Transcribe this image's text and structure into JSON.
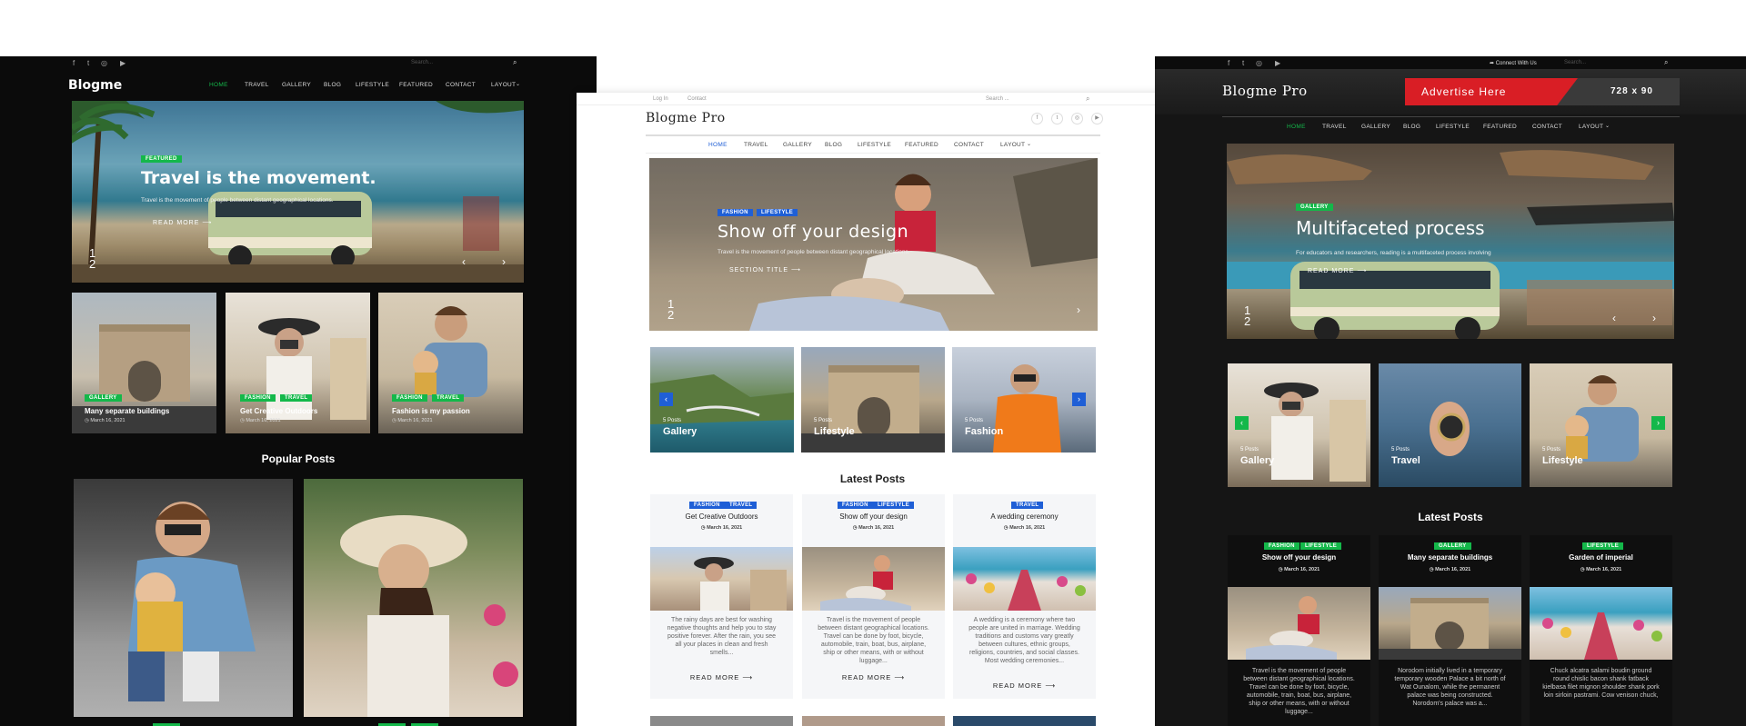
{
  "left": {
    "topbar": {
      "search_placeholder": "Search..."
    },
    "brand": "Blogme",
    "nav": [
      "HOME",
      "TRAVEL",
      "GALLERY",
      "BLOG",
      "LIFESTYLE",
      "FEATURED",
      "CONTACT",
      "LAYOUT"
    ],
    "hero": {
      "tag": "FEATURED",
      "title": "Travel is the movement.",
      "subtitle": "Travel is the movement of people between distant geographical locations.",
      "read_more": "READ MORE",
      "page_current": "1",
      "page_total": "2"
    },
    "tiles": [
      {
        "tags": [
          "GALLERY"
        ],
        "title": "Many separate buildings",
        "date": "March 16, 2021"
      },
      {
        "tags": [
          "FASHION",
          "TRAVEL"
        ],
        "title": "Get Creative Outdoors",
        "date": "March 16, 2021"
      },
      {
        "tags": [
          "FASHION",
          "TRAVEL"
        ],
        "title": "Fashion is my passion",
        "date": "March 16, 2021"
      }
    ],
    "popular_heading": "Popular Posts"
  },
  "center": {
    "topbar": {
      "login": "Log In",
      "contact": "Contact",
      "search_placeholder": "Search ..."
    },
    "brand": "Blogme Pro",
    "nav": [
      "HOME",
      "TRAVEL",
      "GALLERY",
      "BLOG",
      "LIFESTYLE",
      "FEATURED",
      "CONTACT",
      "LAYOUT"
    ],
    "hero": {
      "tags": [
        "FASHION",
        "LIFESTYLE"
      ],
      "title": "Show off your design",
      "subtitle": "Travel is the movement of people between distant geographical locations.",
      "section_title": "SECTION TITLE",
      "page_current": "1",
      "page_total": "2"
    },
    "categories": [
      {
        "count": "5 Posts",
        "name": "Gallery"
      },
      {
        "count": "5 Posts",
        "name": "Lifestyle"
      },
      {
        "count": "5 Posts",
        "name": "Fashion"
      }
    ],
    "latest_heading": "Latest Posts",
    "posts": [
      {
        "tags": [
          "FASHION",
          "TRAVEL"
        ],
        "title": "Get Creative Outdoors",
        "date": "March 16, 2021",
        "excerpt": "The rainy days are best for washing negative thoughts and help you to stay positive forever. After the rain, you see all your places in clean and fresh smells...",
        "read_more": "READ MORE"
      },
      {
        "tags": [
          "FASHION",
          "LIFESTYLE"
        ],
        "title": "Show off your design",
        "date": "March 16, 2021",
        "excerpt": "Travel is the movement of people between distant geographical locations. Travel can be done by foot, bicycle, automobile, train, boat, bus, airplane, ship or other means, with or without luggage...",
        "read_more": "READ MORE"
      },
      {
        "tags": [
          "TRAVEL"
        ],
        "title": "A wedding ceremony",
        "date": "March 16, 2021",
        "excerpt": "A wedding is a ceremony where two people are united in marriage. Wedding traditions and customs vary greatly between cultures, ethnic groups, religions, countries, and social classes. Most wedding ceremonies...",
        "read_more": "READ MORE"
      }
    ]
  },
  "right": {
    "topbar": {
      "connect": "Connect With Us",
      "search_placeholder": "Search..."
    },
    "brand": "Blogme Pro",
    "ad": {
      "text": "Advertise Here",
      "size": "728 x 90"
    },
    "nav": [
      "HOME",
      "TRAVEL",
      "GALLERY",
      "BLOG",
      "LIFESTYLE",
      "FEATURED",
      "CONTACT",
      "LAYOUT"
    ],
    "hero": {
      "tag": "GALLERY",
      "title": "Multifaceted process",
      "subtitle": "For educators and researchers, reading is a multifaceted process involving",
      "read_more": "READ MORE",
      "page_current": "1",
      "page_total": "2"
    },
    "categories": [
      {
        "count": "5 Posts",
        "name": "Gallery"
      },
      {
        "count": "5 Posts",
        "name": "Travel"
      },
      {
        "count": "5 Posts",
        "name": "Lifestyle"
      }
    ],
    "latest_heading": "Latest Posts",
    "posts": [
      {
        "tags": [
          "FASHION",
          "LIFESTYLE"
        ],
        "title": "Show off your design",
        "date": "March 16, 2021",
        "excerpt": "Travel is the movement of people between distant geographical locations. Travel can be done by foot, bicycle, automobile, train, boat, bus, airplane, ship or other means, with or without luggage..."
      },
      {
        "tags": [
          "GALLERY"
        ],
        "title": "Many separate buildings",
        "date": "March 16, 2021",
        "excerpt": "Norodom initially lived in a temporary temporary wooden Palace a bit north of Wat Ounalom, while the permanent palace was being constructed. Norodom's palace was a..."
      },
      {
        "tags": [
          "LIFESTYLE"
        ],
        "title": "Garden of imperial",
        "date": "March 16, 2021",
        "excerpt": "Chuck alcatra salami boudin ground round chislic bacon shank fatback kielbasa filet mignon shoulder shank pork loin sirloin pastrami. Cow venison chuck,"
      }
    ]
  }
}
